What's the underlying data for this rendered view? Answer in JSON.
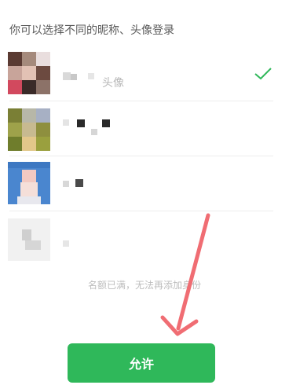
{
  "header": {
    "prompt": "你可以选择不同的昵称、头像登录"
  },
  "accounts": [
    {
      "label": "头像",
      "selected": true
    },
    {
      "label": "",
      "selected": false
    },
    {
      "label": "",
      "selected": false
    },
    {
      "label": "",
      "selected": false
    }
  ],
  "footer": {
    "quota_text": "名额已满，无法再添加身份",
    "allow_label": "允许"
  },
  "colors": {
    "accent": "#2fb85a",
    "annotation_arrow": "#f06d73"
  }
}
